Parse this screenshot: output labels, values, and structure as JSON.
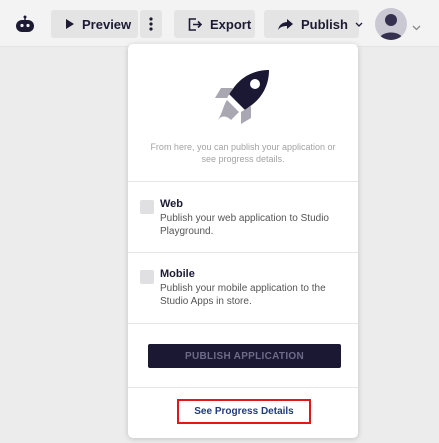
{
  "toolbar": {
    "preview_label": "Preview",
    "export_label": "Export",
    "publish_label": "Publish"
  },
  "publish_panel": {
    "intro_text": "From here, you can publish your application or see progress details.",
    "options": [
      {
        "title": "Web",
        "description": "Publish your web application to Studio Playground."
      },
      {
        "title": "Mobile",
        "description": "Publish your mobile application to the Studio Apps in store."
      }
    ],
    "publish_button_label": "PUBLISH APPLICATION",
    "progress_link_label": "See Progress Details"
  },
  "icons": [
    "robot-logo-icon",
    "play-icon",
    "more-vertical-icon",
    "export-icon",
    "share-arrow-icon",
    "chevron-down-icon",
    "user-avatar-icon",
    "rocket-icon"
  ],
  "colors": {
    "brand_dark": "#1b1833",
    "highlight_border": "#e01818",
    "link": "#1f3c7a"
  }
}
